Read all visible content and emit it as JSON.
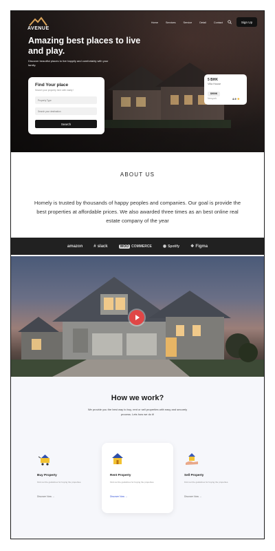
{
  "header": {
    "logo_text": "AVENUE",
    "nav": [
      "Home",
      "Services",
      "Service",
      "Detail",
      "Contact"
    ],
    "signup_label": "Sign Up"
  },
  "hero": {
    "title": "Amazing best places to live and play.",
    "subtitle": "Discover beautiful places to live happily and comfortably with your family.",
    "search_card": {
      "title": "Find Your place",
      "subtitle": "Search your property here with easily !",
      "property_type_placeholder": "Property Type",
      "destination_placeholder": "Search your destination",
      "button_label": "Search"
    },
    "property_card": {
      "bhk": "5 BHK",
      "name": "Villa House",
      "price": "$900K",
      "location": "Newyork",
      "rating": "4.9"
    }
  },
  "about": {
    "heading": "ABOUT US",
    "text": "Homely is trusted by thousands of happy peoples and companies. Our goal is provide the best properties at affordable prices. We also awarded three times as an best online real estate company of the year"
  },
  "brands": [
    "amazon",
    "slack",
    "COMMERCE",
    "Spotify",
    "Figma"
  ],
  "how": {
    "heading": "How we work?",
    "subtitle": "We provide you the best way to buy, rent or sell properties with easy and securely process. Lets how we do it!",
    "steps": [
      {
        "title": "Buy Property",
        "desc": "Find out the guidelines for buying the properties.",
        "link": "Discover Now →"
      },
      {
        "title": "Rent Property",
        "desc": "Find out the guidelines for buying the properties.",
        "link": "Discover Now →"
      },
      {
        "title": "Sell Property",
        "desc": "Find out the guidelines for buying the properties.",
        "link": "Discover Now →"
      }
    ]
  },
  "colors": {
    "accent_dark": "#161616",
    "play_button": "#e04646",
    "star": "#f2b01e",
    "link_active": "#2f4fd6"
  }
}
